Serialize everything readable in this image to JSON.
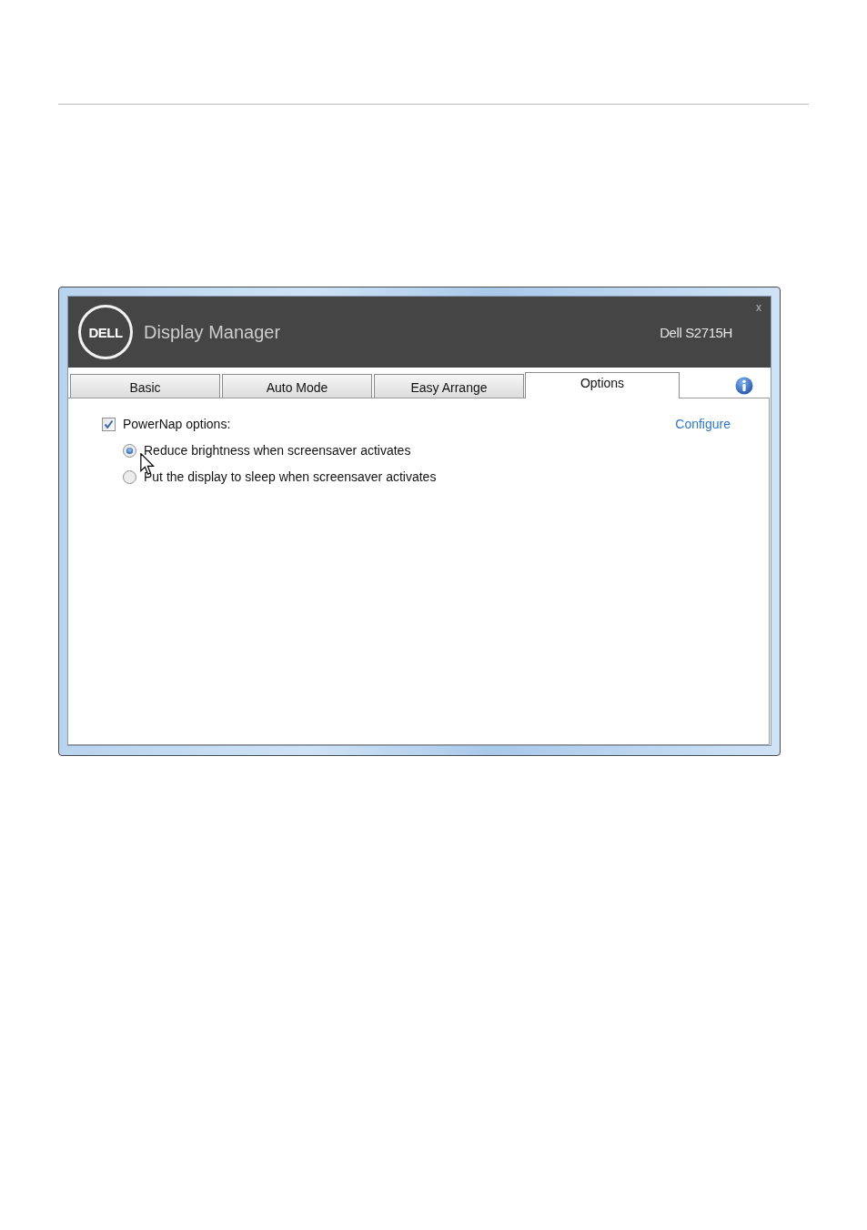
{
  "window": {
    "logo_text": "DELL",
    "title": "Display Manager",
    "monitor": "Dell S2715H",
    "close": "x"
  },
  "tabs": [
    {
      "label": "Basic",
      "selected": false
    },
    {
      "label": "Auto Mode",
      "selected": false
    },
    {
      "label": "Easy Arrange",
      "selected": false
    },
    {
      "label": "Options",
      "selected": true
    }
  ],
  "powernap": {
    "label": "PowerNap options:",
    "checked": true,
    "configure_link": "Configure",
    "options": [
      {
        "label": "Reduce brightness when screensaver activates",
        "selected": true
      },
      {
        "label": "Put the display to sleep when screensaver activates",
        "selected": false
      }
    ]
  }
}
